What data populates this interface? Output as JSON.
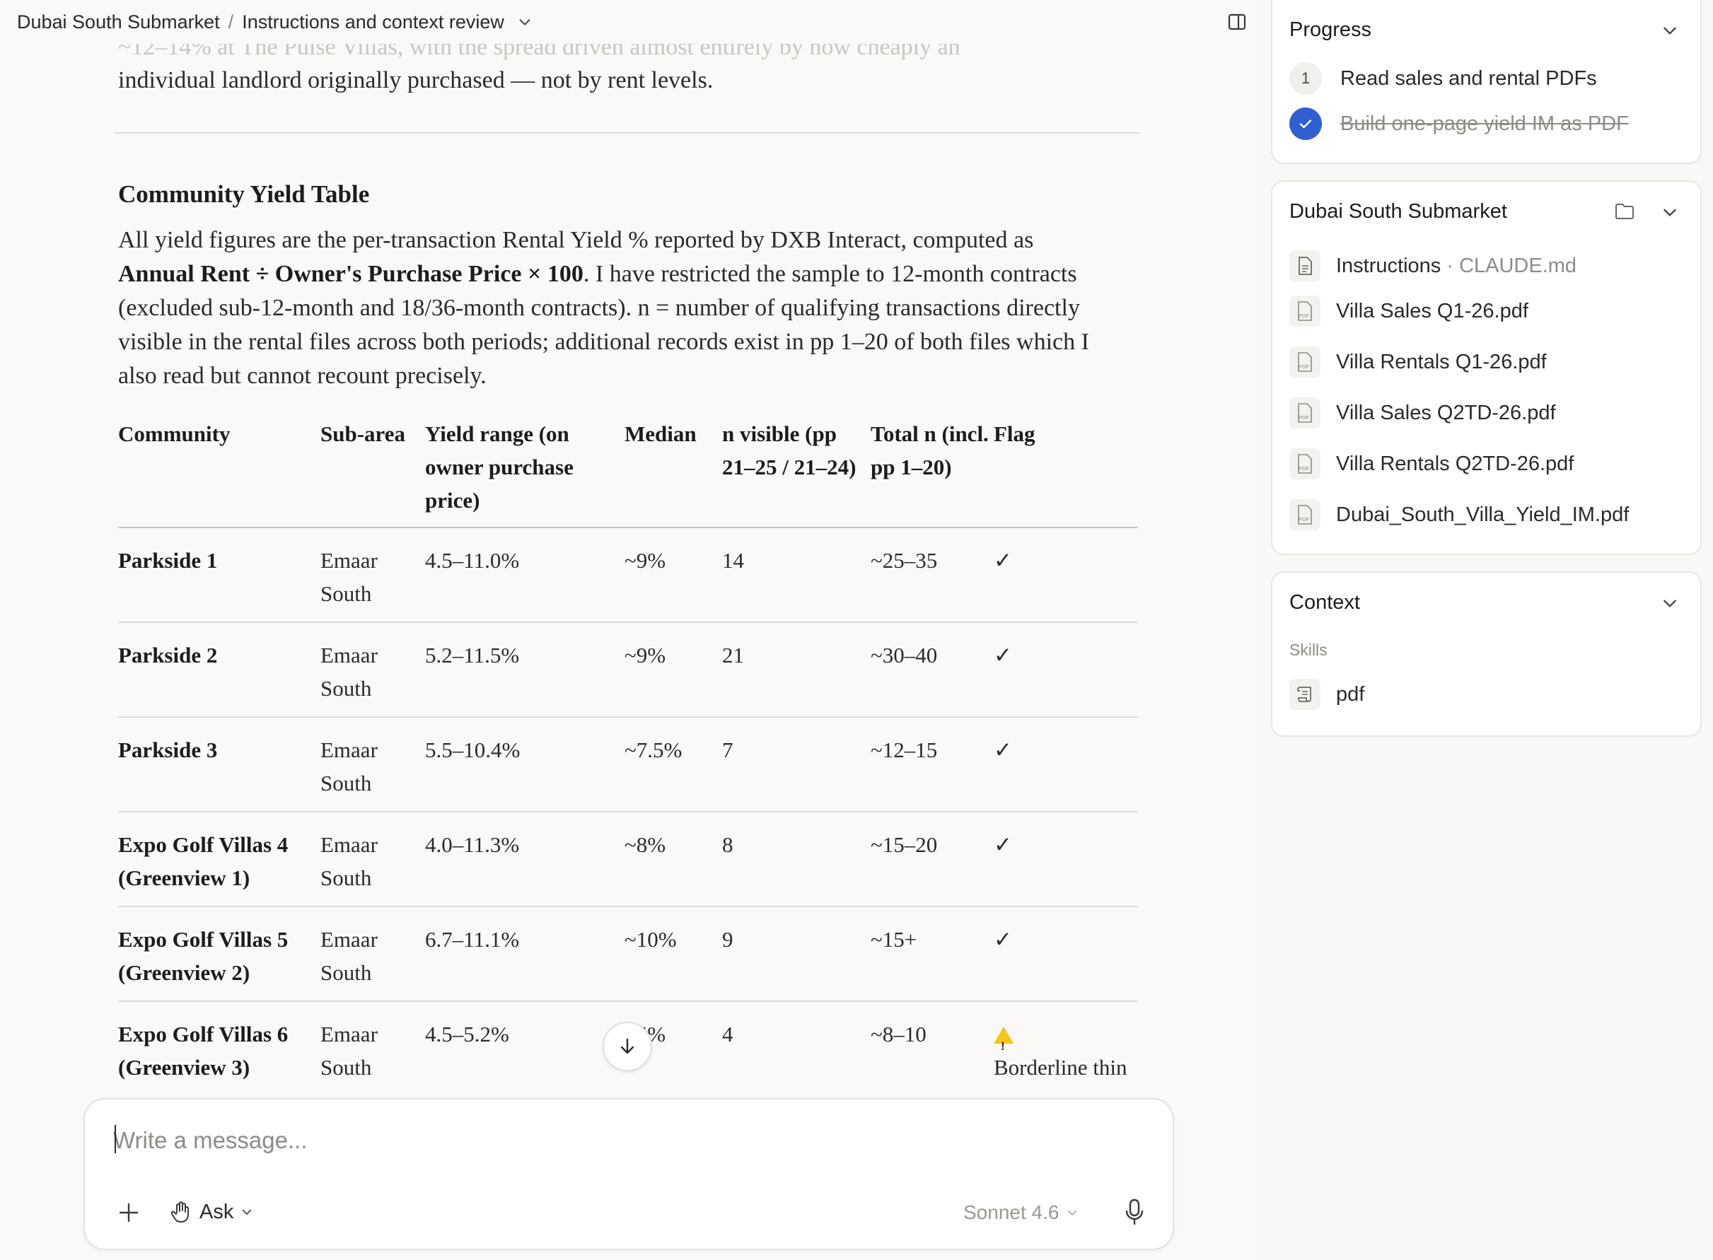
{
  "breadcrumb": {
    "project": "Dubai South Submarket",
    "separator": "/",
    "chat": "Instructions and context review"
  },
  "document": {
    "faded_text": "~12–14% at The Pulse Villas, with the spread driven almost entirely by how cheaply an",
    "paragraph_end": "individual landlord originally purchased — not by rent levels.",
    "section_title": "Community Yield Table",
    "body_1": "All yield figures are the per-transaction Rental Yield % reported by DXB Interact, computed as ",
    "body_bold": "Annual Rent ÷ Owner's Purchase Price × 100",
    "body_2": ". I have restricted the sample to 12-month contracts (excluded sub-12-month and 18/36-month contracts). n = number of qualifying transactions directly visible in the rental files across both periods; additional records exist in pp 1–20 of both files which I also read but cannot recount precisely.",
    "table": {
      "headers": [
        "Community",
        "Sub-area",
        "Yield range (on owner purchase price)",
        "Median",
        "n visible (pp 21–25 / 21–24)",
        "Total n (incl. pp 1–20)",
        "Flag"
      ],
      "rows": [
        {
          "community": "Parkside 1",
          "subarea": "Emaar South",
          "range": "4.5–11.0%",
          "median": "~9%",
          "n": "14",
          "total": "~25–35",
          "flag": "✓"
        },
        {
          "community": "Parkside 2",
          "subarea": "Emaar South",
          "range": "5.2–11.5%",
          "median": "~9%",
          "n": "21",
          "total": "~30–40",
          "flag": "✓"
        },
        {
          "community": "Parkside 3",
          "subarea": "Emaar South",
          "range": "5.5–10.4%",
          "median": "~7.5%",
          "n": "7",
          "total": "~12–15",
          "flag": "✓"
        },
        {
          "community": "Expo Golf Villas 4 (Greenview 1)",
          "subarea": "Emaar South",
          "range": "4.0–11.3%",
          "median": "~8%",
          "n": "8",
          "total": "~15–20",
          "flag": "✓"
        },
        {
          "community": "Expo Golf Villas 5 (Greenview 2)",
          "subarea": "Emaar South",
          "range": "6.7–11.1%",
          "median": "~10%",
          "n": "9",
          "total": "~15+",
          "flag": "✓"
        },
        {
          "community": "Expo Golf Villas 6 (Greenview 3)",
          "subarea": "Emaar South",
          "range": "4.5–5.2%",
          "median": "~5%",
          "n": "4",
          "total": "~8–10",
          "flag": "Borderline thin"
        }
      ]
    }
  },
  "composer": {
    "placeholder": "Write a message...",
    "mode_label": "Ask",
    "model_label": "Sonnet 4.6"
  },
  "progress": {
    "title": "Progress",
    "steps": [
      {
        "number": "1",
        "label": "Read sales and rental PDFs",
        "done": false
      },
      {
        "label": "Build one-page yield IM as PDF",
        "done": true
      }
    ]
  },
  "files": {
    "title": "Dubai South Submarket",
    "instructions_label": "Instructions",
    "instructions_sep": " · ",
    "instructions_file": "CLAUDE.md",
    "items": [
      "Villa Sales Q1-26.pdf",
      "Villa Rentals Q1-26.pdf",
      "Villa Sales Q2TD-26.pdf",
      "Villa Rentals Q2TD-26.pdf",
      "Dubai_South_Villa_Yield_IM.pdf"
    ],
    "pdf_badge": "PDF"
  },
  "context": {
    "title": "Context",
    "skills_label": "Skills",
    "skills": [
      "pdf"
    ]
  },
  "colors": {
    "accent_blue": "#2f5fd0",
    "warning_yellow": "#f5c518",
    "background": "#faf9f7"
  }
}
